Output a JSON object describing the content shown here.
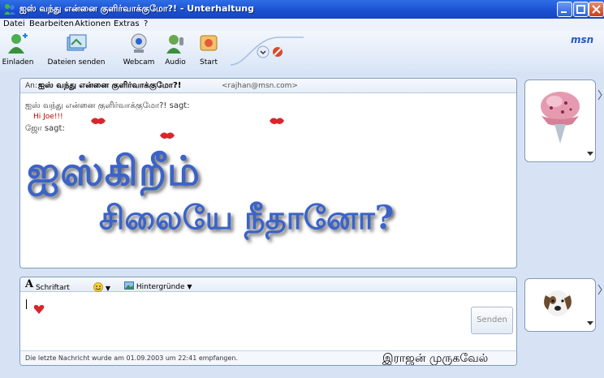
{
  "window": {
    "title": "ஐஸ் வந்து என்னை குளிர்வாக்குமோ?! - Unterhaltung"
  },
  "menu": {
    "items": [
      "Datei",
      "Bearbeiten",
      "Aktionen",
      "Extras",
      "?"
    ]
  },
  "toolbar": {
    "items": [
      {
        "label": "Einladen",
        "icon": "invite-contact-icon"
      },
      {
        "label": "Dateien senden",
        "icon": "send-files-icon"
      },
      {
        "label": "Webcam",
        "icon": "webcam-icon"
      },
      {
        "label": "Audio",
        "icon": "audio-icon"
      },
      {
        "label": "Start",
        "icon": "start-activities-icon"
      }
    ],
    "logo": "msn"
  },
  "conversation": {
    "to_label": "An:",
    "to_name": "ஐஸ் வந்து என்னை குளிர்வாக்குமோ?!",
    "to_email": "<rajhan@msn.com>",
    "messages": [
      {
        "sender": "ஐஸ் வந்து என்னை குளிர்வாக்குமோ?! sagt:",
        "text": "Hi Joe!!!"
      },
      {
        "sender": "ஜோ sagt:"
      }
    ],
    "art_line1": "ஐஸ்கிறீம்",
    "art_line2": "சிலையே நீதானோ?"
  },
  "input": {
    "font_label": "Schriftart",
    "backgrounds_label": "Hintergründe",
    "send_label": "Senden",
    "status": "Die letzte Nachricht wurde am 01.09.2003 um 22:41 empfangen.",
    "signature": "இராஜன் முருகவேல்"
  },
  "colors": {
    "title_bar": "#1a4fcf",
    "accent": "#3b63c8",
    "message_red": "#c00000",
    "frame_bg": "#d7e3f5"
  }
}
